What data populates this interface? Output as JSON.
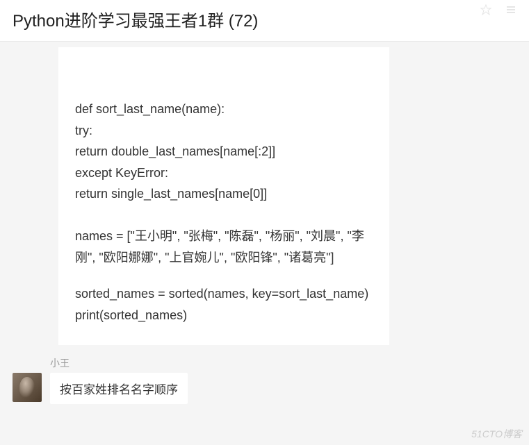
{
  "header": {
    "title": "Python进阶学习最强王者1群 (72)"
  },
  "messages": {
    "code": {
      "l1": "def sort_last_name(name):",
      "l2": "try:",
      "l3": "return double_last_names[name[:2]]",
      "l4": "except KeyError:",
      "l5": "return single_last_names[name[0]]",
      "l6": "names = [\"王小明\", \"张梅\", \"陈磊\", \"杨丽\", \"刘晨\", \"李刚\", \"欧阳娜娜\", \"上官婉儿\", \"欧阳锋\", \"诸葛亮\"]",
      "l7": "sorted_names = sorted(names, key=sort_last_name)",
      "l8": "print(sorted_names)"
    },
    "msg2": {
      "sender": "小王",
      "text": "按百家姓排名名字顺序"
    }
  },
  "watermark": "51CTO博客"
}
